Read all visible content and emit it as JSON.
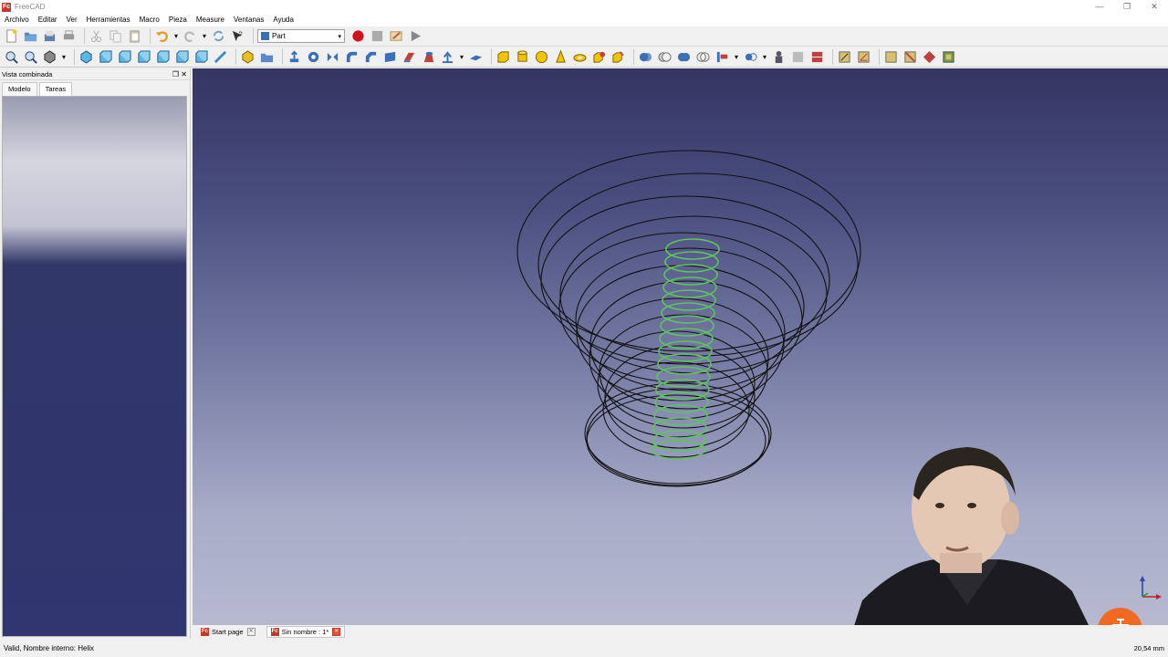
{
  "window": {
    "title": "FreeCAD",
    "app_icon_label": "Fc"
  },
  "menu": [
    "Archivo",
    "Editar",
    "Ver",
    "Herramientas",
    "Macro",
    "Pieza",
    "Measure",
    "Ventanas",
    "Ayuda"
  ],
  "workbench": {
    "selected": "Part"
  },
  "combo_view": {
    "title": "Vista combinada",
    "tabs": [
      "Modelo",
      "Tareas"
    ],
    "active_tab": "Tareas"
  },
  "doc_tabs": [
    {
      "label": "Start page",
      "active": false
    },
    {
      "label": "Sin nombre : 1*",
      "active": true
    }
  ],
  "status": {
    "message": "Valid, Nombre interno: Helix",
    "dimensions": "20,54 mm"
  },
  "colors": {
    "accent_red": "#c0392b",
    "record_red": "#d0101a",
    "helix_green": "#5ec45e",
    "badge_orange": "#f26a21"
  },
  "icons": {
    "toolbar1": [
      "new-icon",
      "open-icon",
      "save-icon",
      "print-icon",
      "cut-icon",
      "copy-icon",
      "paste-icon",
      "undo-icon",
      "redo-icon",
      "refresh-icon",
      "whats-this-icon"
    ],
    "macro": [
      "record-macro-icon",
      "stop-macro-icon",
      "edit-macro-icon",
      "run-macro-icon"
    ]
  }
}
